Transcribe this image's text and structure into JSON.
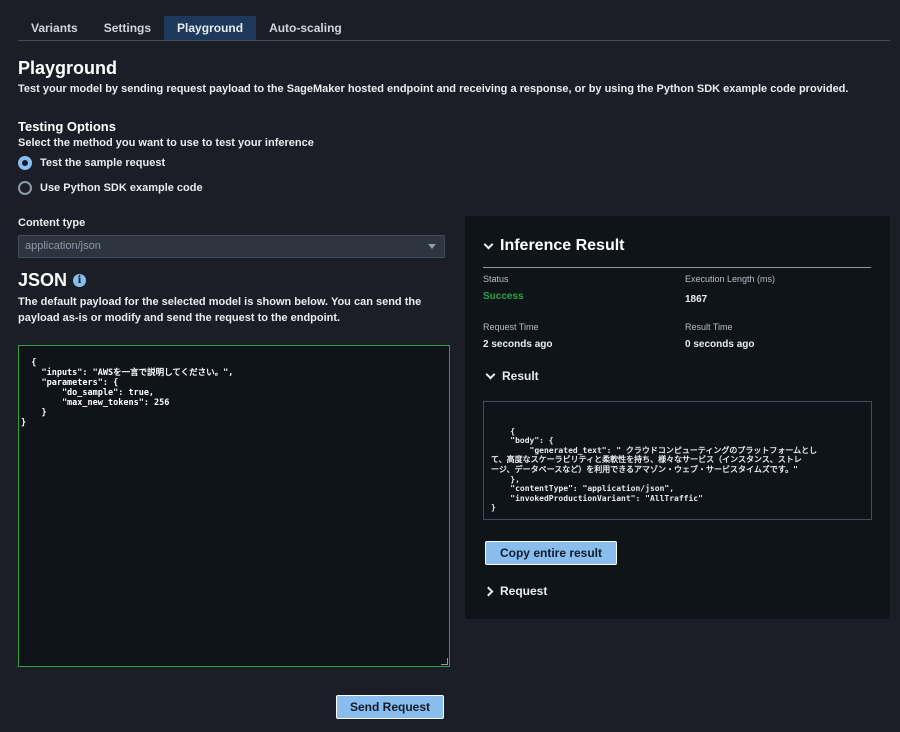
{
  "tabs": [
    {
      "label": "Variants"
    },
    {
      "label": "Settings"
    },
    {
      "label": "Playground"
    },
    {
      "label": "Auto-scaling"
    }
  ],
  "page": {
    "title": "Playground",
    "subtitle": "Test your model by sending request payload to the SageMaker hosted endpoint and receiving a response, or by using the Python SDK example code provided."
  },
  "testing_options": {
    "title": "Testing Options",
    "hint": "Select the method you want to use to test your inference",
    "options": [
      {
        "label": "Test the sample request",
        "checked": true
      },
      {
        "label": "Use Python SDK example code",
        "checked": false
      }
    ]
  },
  "content_type": {
    "label": "Content type",
    "value": "application/json"
  },
  "json_section": {
    "title": "JSON",
    "info_icon": "info-icon",
    "description": "The default payload for the selected model is shown below. You can send the payload as-is or modify and send the request to the endpoint.",
    "payload": "{\n    \"inputs\": \"AWSを一言で説明してください。\",\n    \"parameters\": {\n        \"do_sample\": true,\n        \"max_new_tokens\": 256\n    }\n}"
  },
  "send_button": "Send Request",
  "inference": {
    "title": "Inference Result",
    "status_label": "Status",
    "status_value": "Success",
    "exec_label": "Execution Length (ms)",
    "exec_value": "1867",
    "req_time_label": "Request Time",
    "req_time_value": "2 seconds ago",
    "res_time_label": "Result Time",
    "res_time_value": "0 seconds ago",
    "result_label": "Result",
    "result_body": "{\n    \"body\": {\n        \"generated_text\": \" クラウドコンピューティングのプラットフォームとし\nて、高度なスケーラビリティと柔軟性を持ち、様々なサービス（インスタンス、ストレ\nージ、データベースなど）を利用できるアマゾン・ウェブ・サービスタイムズです。\"\n    },\n    \"contentType\": \"application/json\",\n    \"invokedProductionVariant\": \"AllTraffic\"\n}",
    "copy_button": "Copy entire result",
    "request_label": "Request"
  },
  "colors": {
    "background": "#1b1e26",
    "accent": "#89bdee",
    "success": "#2ea043",
    "active_tab": "#1d3a5c"
  }
}
